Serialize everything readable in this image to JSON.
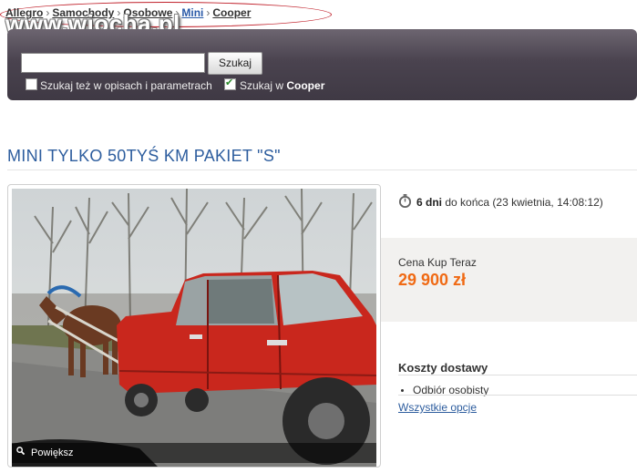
{
  "breadcrumb": {
    "items": [
      "Allegro",
      "Samochody",
      "Osobowe",
      "Mini",
      "Cooper"
    ],
    "watermark": "www.wiocha.pl"
  },
  "search": {
    "query": "",
    "button_label": "Szukaj",
    "option_descriptions": {
      "label": "Szukaj też w opisach i parametrach",
      "checked": false
    },
    "option_category": {
      "label_prefix": "Szukaj w ",
      "category": "Cooper",
      "checked": true
    }
  },
  "listing": {
    "title": "MINI TYLKO 50TYŚ KM PAKIET \"S\"",
    "zoom_label": "Powiększ"
  },
  "timer": {
    "days": "6 dni",
    "suffix": "do końca (23 kwietnia, 14:08:12)"
  },
  "price": {
    "label": "Cena Kup Teraz",
    "value": "29 900 zł",
    "color": "#f06a14"
  },
  "shipping": {
    "title": "Koszty dostawy",
    "items": [
      "Odbiór osobisty"
    ],
    "all_options_link": "Wszystkie opcje"
  },
  "icons": {
    "timer": "stopwatch-icon",
    "zoom": "magnifier-icon"
  }
}
